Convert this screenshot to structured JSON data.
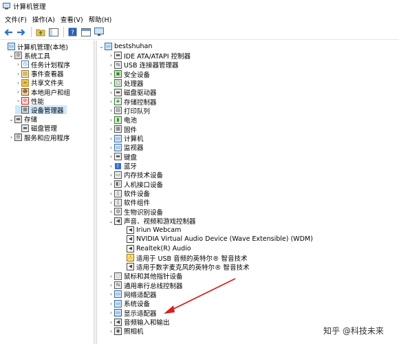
{
  "window": {
    "title": "计算机管理"
  },
  "menu": [
    "文件(F)",
    "操作(A)",
    "查看(V)",
    "帮助(H)"
  ],
  "toolbar": {
    "icons": [
      "back-icon",
      "forward-icon",
      "folder-up-icon",
      "console-tree-icon",
      "help-icon",
      "properties-icon",
      "monitor-icon"
    ]
  },
  "left_tree": [
    {
      "label": "计算机管理(本地)",
      "level": 0,
      "expander": "",
      "icon": "computer-manage-icon"
    },
    {
      "label": "系统工具",
      "level": 1,
      "expander": "v",
      "icon": "tools-icon"
    },
    {
      "label": "任务计划程序",
      "level": 2,
      "expander": ">",
      "icon": "clock-icon"
    },
    {
      "label": "事件查看器",
      "level": 2,
      "expander": ">",
      "icon": "event-icon"
    },
    {
      "label": "共享文件夹",
      "level": 2,
      "expander": ">",
      "icon": "share-folder-icon"
    },
    {
      "label": "本地用户和组",
      "level": 2,
      "expander": ">",
      "icon": "users-icon"
    },
    {
      "label": "性能",
      "level": 2,
      "expander": ">",
      "icon": "performance-icon"
    },
    {
      "label": "设备管理器",
      "level": 2,
      "expander": "",
      "icon": "device-manager-icon",
      "selected": true
    },
    {
      "label": "存储",
      "level": 1,
      "expander": "v",
      "icon": "storage-icon"
    },
    {
      "label": "磁盘管理",
      "level": 2,
      "expander": "",
      "icon": "disk-icon"
    },
    {
      "label": "服务和应用程序",
      "level": 1,
      "expander": ">",
      "icon": "services-icon"
    }
  ],
  "device_tree": {
    "root": "bestshuhan",
    "categories": [
      {
        "label": "IDE ATA/ATAPI 控制器",
        "icon": "ide-icon"
      },
      {
        "label": "USB 连接器管理器",
        "icon": "usb-icon"
      },
      {
        "label": "安全设备",
        "icon": "security-icon"
      },
      {
        "label": "处理器",
        "icon": "cpu-icon"
      },
      {
        "label": "磁盘驱动器",
        "icon": "disk-drive-icon"
      },
      {
        "label": "存储控制器",
        "icon": "storage-controller-icon"
      },
      {
        "label": "打印队列",
        "icon": "printer-icon"
      },
      {
        "label": "电池",
        "icon": "battery-icon"
      },
      {
        "label": "固件",
        "icon": "firmware-icon"
      },
      {
        "label": "计算机",
        "icon": "computer-icon"
      },
      {
        "label": "监视器",
        "icon": "monitor-icon"
      },
      {
        "label": "键盘",
        "icon": "keyboard-icon"
      },
      {
        "label": "蓝牙",
        "icon": "bluetooth-icon"
      },
      {
        "label": "内存技术设备",
        "icon": "memory-icon"
      },
      {
        "label": "人机接口设备",
        "icon": "hid-icon"
      },
      {
        "label": "软件设备",
        "icon": "software-device-icon"
      },
      {
        "label": "软件组件",
        "icon": "software-component-icon"
      },
      {
        "label": "生物识别设备",
        "icon": "biometric-icon"
      },
      {
        "label": "声音、视频和游戏控制器",
        "icon": "sound-icon",
        "expanded": true,
        "children": [
          {
            "label": "Iriun Webcam",
            "icon": "speaker-icon"
          },
          {
            "label": "NVIDIA Virtual Audio Device (Wave Extensible) (WDM)",
            "icon": "speaker-icon"
          },
          {
            "label": "Realtek(R) Audio",
            "icon": "speaker-icon"
          },
          {
            "label": "适用于 USB 音频的英特尔® 智音技术",
            "icon": "warning-speaker-icon"
          },
          {
            "label": "适用于数字麦克风的英特尔® 智音技术",
            "icon": "speaker-icon"
          }
        ]
      },
      {
        "label": "鼠标和其他指针设备",
        "icon": "mouse-icon"
      },
      {
        "label": "通用串行总线控制器",
        "icon": "usb-controller-icon"
      },
      {
        "label": "网络适配器",
        "icon": "network-icon"
      },
      {
        "label": "系统设备",
        "icon": "system-device-icon"
      },
      {
        "label": "显示适配器",
        "icon": "display-adapter-icon"
      },
      {
        "label": "音频输入和输出",
        "icon": "audio-io-icon"
      },
      {
        "label": "照相机",
        "icon": "camera-icon"
      }
    ]
  },
  "watermark": {
    "text": "知乎 @科技未来"
  },
  "colors": {
    "selection": "#cce8ff",
    "arrow": "#d62020"
  }
}
